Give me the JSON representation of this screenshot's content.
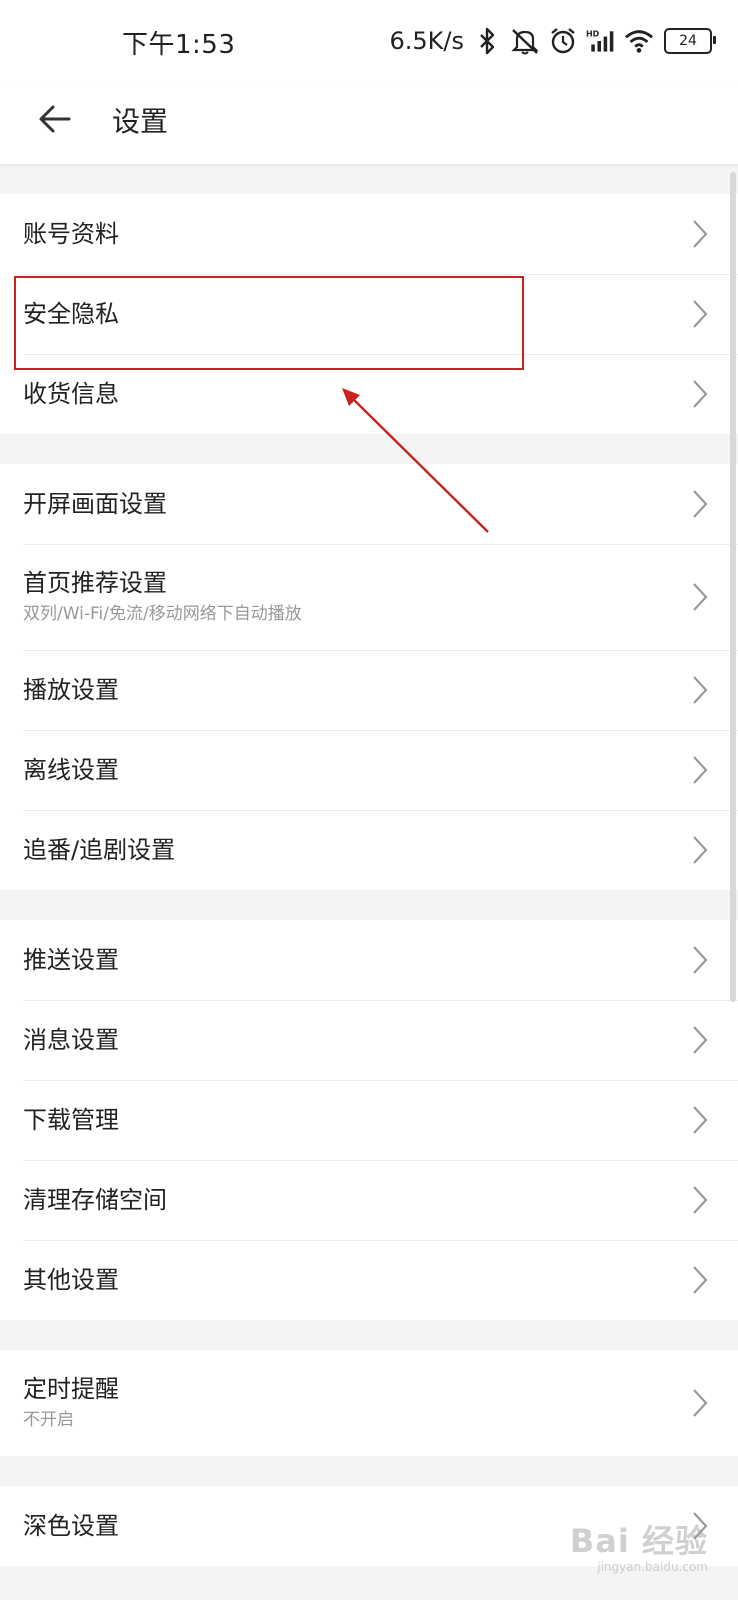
{
  "status_bar": {
    "time": "下午1:53",
    "network_speed": "6.5K/s",
    "battery_level": "24",
    "icons": [
      "bluetooth-icon",
      "mute-notification-icon",
      "alarm-icon",
      "hd-signal-icon",
      "wifi-icon",
      "battery-icon"
    ]
  },
  "header": {
    "title": "设置",
    "back_icon": "back-arrow-icon"
  },
  "sections": [
    {
      "items": [
        {
          "label": "账号资料"
        },
        {
          "label": "安全隐私"
        },
        {
          "label": "收货信息"
        }
      ]
    },
    {
      "items": [
        {
          "label": "开屏画面设置"
        },
        {
          "label": "首页推荐设置",
          "sub": "双列/Wi-Fi/免流/移动网络下自动播放"
        },
        {
          "label": "播放设置"
        },
        {
          "label": "离线设置"
        },
        {
          "label": "追番/追剧设置"
        }
      ]
    },
    {
      "items": [
        {
          "label": "推送设置"
        },
        {
          "label": "消息设置"
        },
        {
          "label": "下载管理"
        },
        {
          "label": "清理存储空间"
        },
        {
          "label": "其他设置"
        }
      ]
    },
    {
      "items": [
        {
          "label": "定时提醒",
          "sub": "不开启"
        }
      ]
    },
    {
      "items": [
        {
          "label": "深色设置"
        }
      ]
    }
  ],
  "annotation": {
    "color": "#c9211e",
    "highlighted_item": "安全隐私"
  },
  "watermark": {
    "main": "Bai 经验",
    "sub": "jingyan.baidu.com"
  }
}
